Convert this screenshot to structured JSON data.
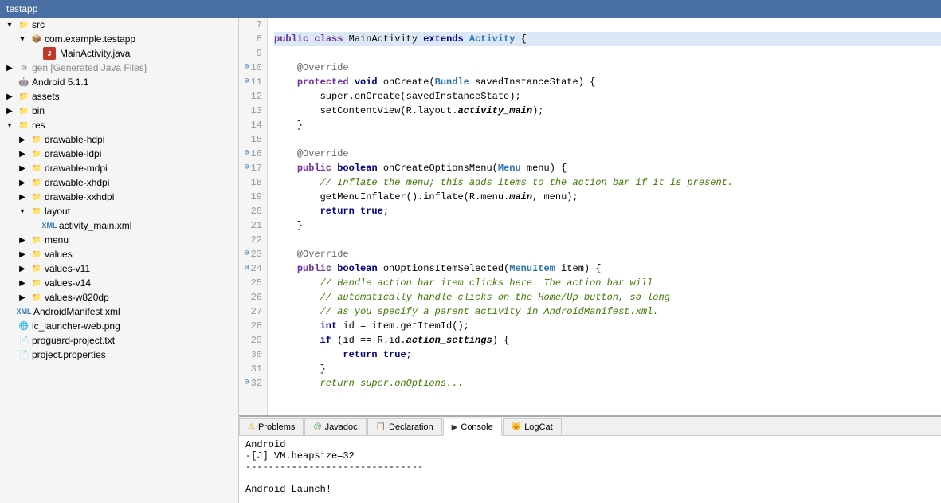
{
  "titlebar": {
    "title": "testapp"
  },
  "sidebar": {
    "items": [
      {
        "id": "src",
        "label": "src",
        "indent": 1,
        "icon": "folder",
        "expanded": true
      },
      {
        "id": "com-example",
        "label": "com.example.testapp",
        "indent": 2,
        "icon": "package",
        "expanded": true
      },
      {
        "id": "mainactivity",
        "label": "MainActivity.java",
        "indent": 3,
        "icon": "java"
      },
      {
        "id": "gen",
        "label": "gen [Generated Java Files]",
        "indent": 1,
        "icon": "gen",
        "expanded": false
      },
      {
        "id": "android511",
        "label": "Android 5.1.1",
        "indent": 1,
        "icon": "android"
      },
      {
        "id": "assets",
        "label": "assets",
        "indent": 1,
        "icon": "folder"
      },
      {
        "id": "bin",
        "label": "bin",
        "indent": 1,
        "icon": "folder"
      },
      {
        "id": "res",
        "label": "res",
        "indent": 1,
        "icon": "folder",
        "expanded": true
      },
      {
        "id": "drawable-hdpi",
        "label": "drawable-hdpi",
        "indent": 2,
        "icon": "folder"
      },
      {
        "id": "drawable-ldpi",
        "label": "drawable-ldpi",
        "indent": 2,
        "icon": "folder"
      },
      {
        "id": "drawable-mdpi",
        "label": "drawable-mdpi",
        "indent": 2,
        "icon": "folder"
      },
      {
        "id": "drawable-xhdpi",
        "label": "drawable-xhdpi",
        "indent": 2,
        "icon": "folder"
      },
      {
        "id": "drawable-xxhdpi",
        "label": "drawable-xxhdpi",
        "indent": 2,
        "icon": "folder"
      },
      {
        "id": "layout",
        "label": "layout",
        "indent": 2,
        "icon": "folder",
        "expanded": true
      },
      {
        "id": "activity-main-xml",
        "label": "activity_main.xml",
        "indent": 3,
        "icon": "xml"
      },
      {
        "id": "menu",
        "label": "menu",
        "indent": 2,
        "icon": "folder"
      },
      {
        "id": "values",
        "label": "values",
        "indent": 2,
        "icon": "folder"
      },
      {
        "id": "values-v11",
        "label": "values-v11",
        "indent": 2,
        "icon": "folder"
      },
      {
        "id": "values-v14",
        "label": "values-v14",
        "indent": 2,
        "icon": "folder"
      },
      {
        "id": "values-w820dp",
        "label": "values-w820dp",
        "indent": 2,
        "icon": "folder"
      },
      {
        "id": "androidmanifest",
        "label": "AndroidManifest.xml",
        "indent": 1,
        "icon": "xml"
      },
      {
        "id": "ic-launcher",
        "label": "ic_launcher-web.png",
        "indent": 1,
        "icon": "png"
      },
      {
        "id": "proguard",
        "label": "proguard-project.txt",
        "indent": 1,
        "icon": "file"
      },
      {
        "id": "project-props",
        "label": "project.properties",
        "indent": 1,
        "icon": "file"
      }
    ]
  },
  "editor": {
    "lines": [
      {
        "num": "7",
        "fold": false,
        "content": [],
        "highlight": false
      },
      {
        "num": "8",
        "fold": false,
        "highlight": true,
        "content": [
          {
            "text": "public ",
            "cls": "kw"
          },
          {
            "text": "class ",
            "cls": "kw"
          },
          {
            "text": "MainActivity ",
            "cls": "plain"
          },
          {
            "text": "extends ",
            "cls": "kw2"
          },
          {
            "text": "Activity ",
            "cls": "cls"
          },
          {
            "text": "{",
            "cls": "plain"
          }
        ]
      },
      {
        "num": "9",
        "fold": false,
        "content": [],
        "highlight": false
      },
      {
        "num": "10",
        "fold": true,
        "content": [
          {
            "text": "    @Override",
            "cls": "annotation"
          }
        ],
        "highlight": false
      },
      {
        "num": "11",
        "fold": true,
        "content": [
          {
            "text": "    ",
            "cls": "plain"
          },
          {
            "text": "protected ",
            "cls": "kw"
          },
          {
            "text": "void ",
            "cls": "kw2"
          },
          {
            "text": "onCreate(",
            "cls": "plain"
          },
          {
            "text": "Bundle ",
            "cls": "cls"
          },
          {
            "text": "savedInstanceState) {",
            "cls": "plain"
          }
        ],
        "highlight": false
      },
      {
        "num": "12",
        "fold": false,
        "content": [
          {
            "text": "        super",
            "cls": "plain"
          },
          {
            "text": ".onCreate(savedInstanceState);",
            "cls": "plain"
          }
        ],
        "highlight": false
      },
      {
        "num": "13",
        "fold": false,
        "content": [
          {
            "text": "        setContentView(R.layout.",
            "cls": "plain"
          },
          {
            "text": "activity_main",
            "cls": "italic"
          },
          {
            "text": ");",
            "cls": "plain"
          }
        ],
        "highlight": false
      },
      {
        "num": "14",
        "fold": false,
        "content": [
          {
            "text": "    }",
            "cls": "plain"
          }
        ],
        "highlight": false
      },
      {
        "num": "15",
        "fold": false,
        "content": [],
        "highlight": false
      },
      {
        "num": "16",
        "fold": true,
        "content": [
          {
            "text": "    @Override",
            "cls": "annotation"
          }
        ],
        "highlight": false
      },
      {
        "num": "17",
        "fold": true,
        "content": [
          {
            "text": "    ",
            "cls": "plain"
          },
          {
            "text": "public ",
            "cls": "kw"
          },
          {
            "text": "boolean ",
            "cls": "kw2"
          },
          {
            "text": "onCreateOptionsMenu(",
            "cls": "plain"
          },
          {
            "text": "Menu ",
            "cls": "cls"
          },
          {
            "text": "menu) {",
            "cls": "plain"
          }
        ],
        "highlight": false
      },
      {
        "num": "18",
        "fold": false,
        "content": [
          {
            "text": "        // Inflate the menu; this adds items to the action bar if it is present.",
            "cls": "comment"
          }
        ],
        "highlight": false
      },
      {
        "num": "19",
        "fold": false,
        "content": [
          {
            "text": "        getMenuInflater().inflate(R.menu.",
            "cls": "plain"
          },
          {
            "text": "main",
            "cls": "italic"
          },
          {
            "text": ", menu);",
            "cls": "plain"
          }
        ],
        "highlight": false
      },
      {
        "num": "20",
        "fold": false,
        "content": [
          {
            "text": "        ",
            "cls": "plain"
          },
          {
            "text": "return ",
            "cls": "kw2"
          },
          {
            "text": "true",
            "cls": "kw2"
          },
          {
            "text": ";",
            "cls": "plain"
          }
        ],
        "highlight": false
      },
      {
        "num": "21",
        "fold": false,
        "content": [
          {
            "text": "    }",
            "cls": "plain"
          }
        ],
        "highlight": false
      },
      {
        "num": "22",
        "fold": false,
        "content": [],
        "highlight": false
      },
      {
        "num": "23",
        "fold": true,
        "content": [
          {
            "text": "    @Override",
            "cls": "annotation"
          }
        ],
        "highlight": false
      },
      {
        "num": "24",
        "fold": true,
        "content": [
          {
            "text": "    ",
            "cls": "plain"
          },
          {
            "text": "public ",
            "cls": "kw"
          },
          {
            "text": "boolean ",
            "cls": "kw2"
          },
          {
            "text": "onOptionsItemSelected(",
            "cls": "plain"
          },
          {
            "text": "MenuItem ",
            "cls": "cls"
          },
          {
            "text": "item) {",
            "cls": "plain"
          }
        ],
        "highlight": false
      },
      {
        "num": "25",
        "fold": false,
        "content": [
          {
            "text": "        // Handle action bar item clicks here. The action bar will",
            "cls": "comment"
          }
        ],
        "highlight": false
      },
      {
        "num": "26",
        "fold": false,
        "content": [
          {
            "text": "        // automatically handle clicks on the Home/Up button, so long",
            "cls": "comment"
          }
        ],
        "highlight": false
      },
      {
        "num": "27",
        "fold": false,
        "content": [
          {
            "text": "        // as you specify a parent activity in AndroidManifest.xml.",
            "cls": "comment"
          }
        ],
        "highlight": false
      },
      {
        "num": "28",
        "fold": false,
        "content": [
          {
            "text": "        ",
            "cls": "plain"
          },
          {
            "text": "int ",
            "cls": "kw2"
          },
          {
            "text": "id = item.getItemId();",
            "cls": "plain"
          }
        ],
        "highlight": false
      },
      {
        "num": "29",
        "fold": false,
        "content": [
          {
            "text": "        ",
            "cls": "plain"
          },
          {
            "text": "if ",
            "cls": "kw2"
          },
          {
            "text": "(id == R.id.",
            "cls": "plain"
          },
          {
            "text": "action_settings",
            "cls": "italic"
          },
          {
            "text": ") {",
            "cls": "plain"
          }
        ],
        "highlight": false
      },
      {
        "num": "30",
        "fold": false,
        "content": [
          {
            "text": "            ",
            "cls": "plain"
          },
          {
            "text": "return ",
            "cls": "kw2"
          },
          {
            "text": "true",
            "cls": "kw2"
          },
          {
            "text": ";",
            "cls": "plain"
          }
        ],
        "highlight": false
      },
      {
        "num": "31",
        "fold": false,
        "content": [
          {
            "text": "        }",
            "cls": "plain"
          }
        ],
        "highlight": false
      },
      {
        "num": "32",
        "fold": true,
        "content": [
          {
            "text": "        return super.onOptions...",
            "cls": "comment"
          }
        ],
        "highlight": false
      }
    ]
  },
  "bottom_panel": {
    "tabs": [
      {
        "id": "problems",
        "label": "Problems",
        "icon": "⚠",
        "active": false
      },
      {
        "id": "javadoc",
        "label": "Javadoc",
        "icon": "@",
        "active": false
      },
      {
        "id": "declaration",
        "label": "Declaration",
        "icon": "📄",
        "active": false
      },
      {
        "id": "console",
        "label": "Console",
        "icon": "▶",
        "active": true
      },
      {
        "id": "logcat",
        "label": "LogCat",
        "icon": "🐱",
        "active": false
      }
    ],
    "console_lines": [
      "Android",
      "-[J] VM.heapsize=32",
      "-------------------------------",
      "",
      "Android Launch!"
    ]
  }
}
